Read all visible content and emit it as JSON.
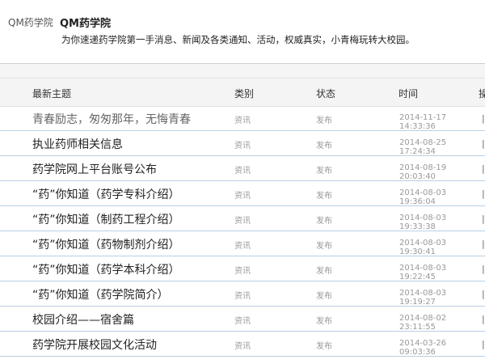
{
  "header": {
    "account_name": "QM药学院",
    "title": "QM药学院",
    "description": "为你速递药学院第一手消息、新闻及各类通知、活动，权威真实，小青梅玩转大校园。"
  },
  "table": {
    "columns": [
      "最新主题",
      "类别",
      "状态",
      "时间",
      "操"
    ],
    "rows": [
      {
        "title": "青春励志，匆匆那年，无悔青春",
        "category": "资讯",
        "status": "发布",
        "time": "2014-11-17 14:33:36",
        "sep": "|"
      },
      {
        "title": "执业药师相关信息",
        "category": "资讯",
        "status": "发布",
        "time": "2014-08-25 17:24:34",
        "sep": "|"
      },
      {
        "title": "药学院网上平台账号公布",
        "category": "资讯",
        "status": "发布",
        "time": "2014-08-19 20:03:40",
        "sep": "|"
      },
      {
        "title": "“药”你知道（药学专科介绍）",
        "category": "资讯",
        "status": "发布",
        "time": "2014-08-03 19:36:04",
        "sep": "|"
      },
      {
        "title": "“药”你知道（制药工程介绍）",
        "category": "资讯",
        "status": "发布",
        "time": "2014-08-03 19:33:38",
        "sep": "|"
      },
      {
        "title": "“药”你知道（药物制剂介绍）",
        "category": "资讯",
        "status": "发布",
        "time": "2014-08-03 19:30:41",
        "sep": "|"
      },
      {
        "title": "“药”你知道（药学本科介绍）",
        "category": "资讯",
        "status": "发布",
        "time": "2014-08-03 19:22:45",
        "sep": "|"
      },
      {
        "title": "“药”你知道（药学院简介）",
        "category": "资讯",
        "status": "发布",
        "time": "2014-08-03 19:19:27",
        "sep": "|"
      },
      {
        "title": "校园介绍——宿舍篇",
        "category": "资讯",
        "status": "发布",
        "time": "2014-08-02 23:11:55",
        "sep": "|"
      },
      {
        "title": "药学院开展校园文化活动",
        "category": "资讯",
        "status": "发布",
        "time": "2014-03-26 09:03:36",
        "sep": "|"
      }
    ]
  }
}
